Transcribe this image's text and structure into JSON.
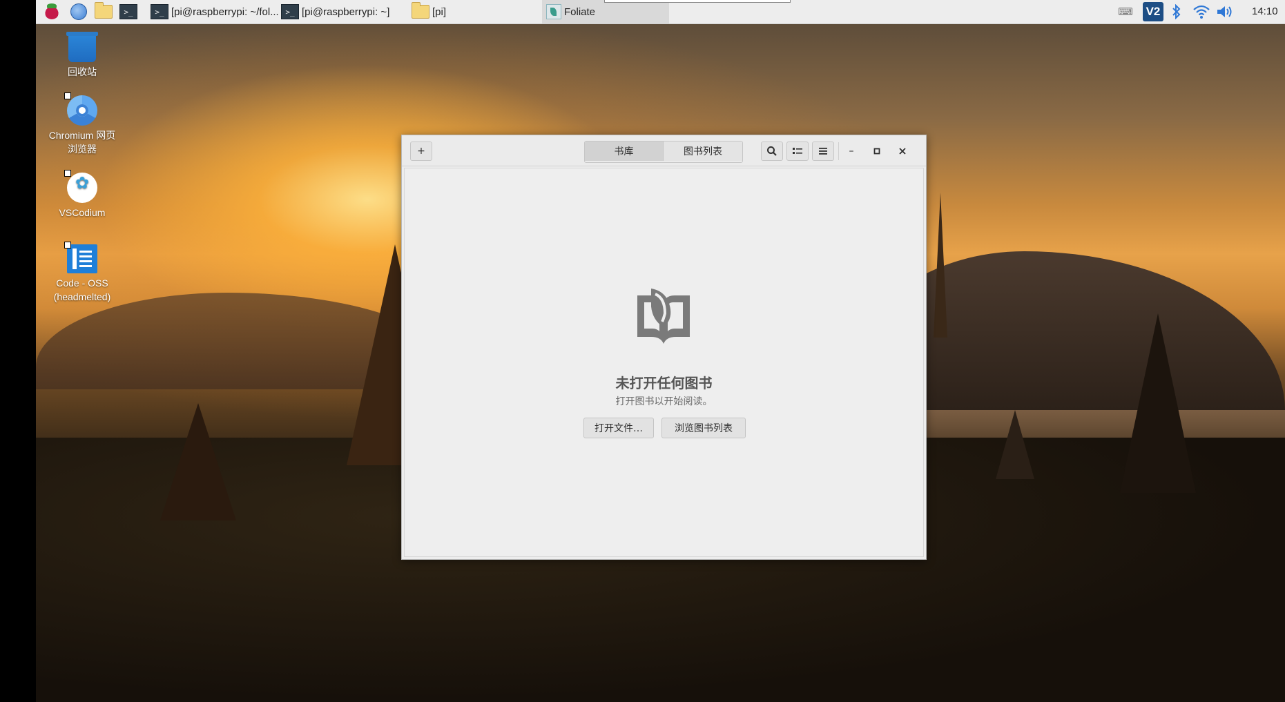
{
  "panel": {
    "icons": [
      "raspberry-menu-icon",
      "web-browser-icon",
      "file-manager-icon",
      "terminal-icon"
    ],
    "tasks": [
      {
        "label": "[pi@raspberrypi: ~/fol...",
        "icon": "terminal-icon"
      },
      {
        "label": "[pi@raspberrypi: ~]",
        "icon": "terminal-icon"
      },
      {
        "label": "[pi]",
        "icon": "folder-icon"
      },
      {
        "label": "Foliate",
        "icon": "foliate-icon",
        "active": true
      }
    ],
    "tray": {
      "vnc_label": "V2",
      "icons": [
        "keyboard-icon",
        "vnc-icon",
        "bluetooth-icon",
        "wifi-icon",
        "volume-icon"
      ],
      "clock": "14:10"
    }
  },
  "desktop": {
    "icons": [
      {
        "label": "回收站",
        "icon": "trash-icon"
      },
      {
        "label": "Chromium 网页\n浏览器",
        "icon": "chromium-icon"
      },
      {
        "label": "VSCodium",
        "icon": "vscodium-icon"
      },
      {
        "label": "Code - OSS\n(headmelted)",
        "icon": "code-oss-icon"
      }
    ]
  },
  "foliate": {
    "header": {
      "add_label": "+",
      "tabs": [
        {
          "label": "书库",
          "active": true
        },
        {
          "label": "图书列表",
          "active": false
        }
      ],
      "controls": {
        "minimize": "–",
        "maximize": "▫",
        "close": "✕"
      }
    },
    "empty_state": {
      "title": "未打开任何图书",
      "subtitle": "打开图书以开始阅读。",
      "open_file_label": "打开文件…",
      "browse_catalog_label": "浏览图书列表"
    }
  },
  "colors": {
    "panel_bg": "#ededed",
    "window_bg": "#ededed",
    "accent_blue": "#2f78d6",
    "empty_icon_grey": "#7a7a7a"
  }
}
